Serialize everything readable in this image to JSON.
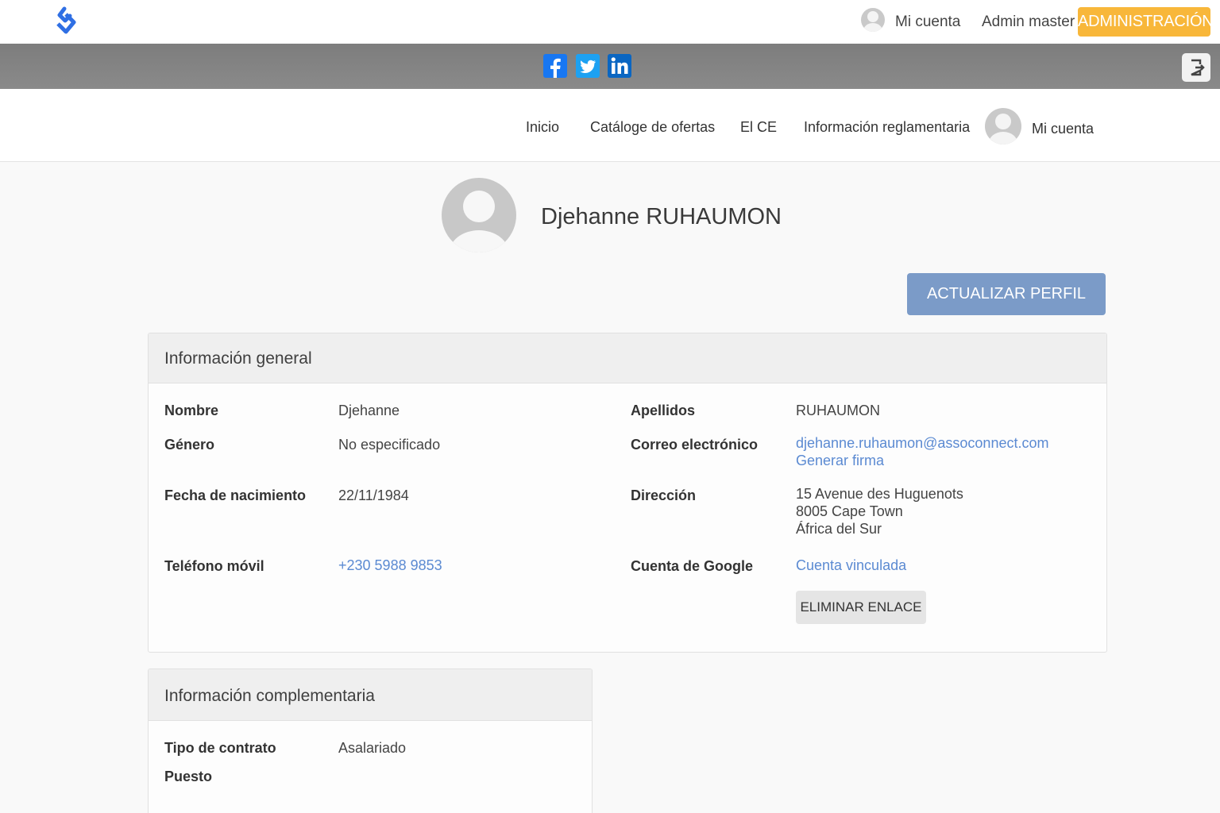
{
  "topbar": {
    "account_label": "Mi cuenta",
    "admin_user": "Admin master",
    "admin_button": "ADMINISTRACIÓN",
    "admin_color": "#f8b73a"
  },
  "social": {
    "icons": [
      "facebook-icon",
      "twitter-icon",
      "linkedin-icon"
    ],
    "labels": [
      "f",
      "t",
      "in"
    ]
  },
  "nav": {
    "items": [
      "Inicio",
      "Catáloge de ofertas",
      "El CE",
      "Información reglamentaria"
    ],
    "account_label": "Mi cuenta"
  },
  "profile": {
    "full_name": "Djehanne RUHAUMON",
    "update_button": "ACTUALIZAR PERFIL",
    "update_button_color": "#7b9bc8"
  },
  "general": {
    "title": "Información general",
    "first_name_label": "Nombre",
    "first_name": "Djehanne",
    "last_name_label": "Apellidos",
    "last_name": "RUHAUMON",
    "gender_label": "Género",
    "gender": "No especificado",
    "email_label": "Correo electrónico",
    "email": "djehanne.ruhaumon@assoconnect.com",
    "generate_signature": "Generar firma",
    "birth_label": "Fecha de nacimiento",
    "birth_date": "22/11/1984",
    "address_label": "Dirección",
    "address_line1": "15 Avenue des Huguenots",
    "address_line2": "8005 Cape Town",
    "address_line3": "África del Sur",
    "mobile_label": "Teléfono móvil",
    "mobile": "+230 5988 9853",
    "google_label": "Cuenta de Google",
    "google_status": "Cuenta vinculada",
    "unlink_button": "ELIMINAR ENLACE",
    "link_color": "#5b8ad2"
  },
  "extra": {
    "title": "Información complementaria",
    "contract_label": "Tipo de contrato",
    "contract": "Asalariado",
    "position_label": "Puesto"
  }
}
